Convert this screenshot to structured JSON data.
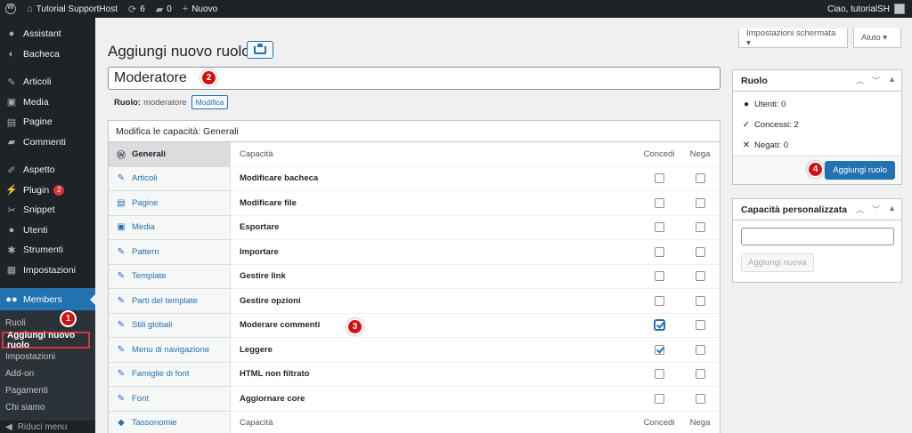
{
  "admin_bar": {
    "site_name": "Tutorial SupportHost",
    "updates_count": "6",
    "comments_count": "0",
    "new_label": "Nuovo",
    "greeting": "Ciao, tutorialSH"
  },
  "sidebar": {
    "items": [
      {
        "label": "Assistant",
        "icon": "person-icon"
      },
      {
        "label": "Bacheca",
        "icon": "dashboard-icon"
      },
      {
        "label": "Articoli",
        "icon": "pin-icon"
      },
      {
        "label": "Media",
        "icon": "media-icon"
      },
      {
        "label": "Pagine",
        "icon": "page-icon"
      },
      {
        "label": "Commenti",
        "icon": "comment-icon"
      },
      {
        "label": "Aspetto",
        "icon": "brush-icon"
      },
      {
        "label": "Plugin",
        "icon": "plugin-icon",
        "badge": "2"
      },
      {
        "label": "Snippet",
        "icon": "scissors-icon"
      },
      {
        "label": "Utenti",
        "icon": "user-icon"
      },
      {
        "label": "Strumenti",
        "icon": "wrench-icon"
      },
      {
        "label": "Impostazioni",
        "icon": "settings-icon"
      }
    ],
    "current": {
      "label": "Members",
      "icon": "members-icon"
    },
    "submenu": [
      "Ruoli",
      "Aggiungi nuovo ruolo",
      "Impostazioni",
      "Add-on",
      "Pagamenti",
      "Chi siamo"
    ],
    "collapse_label": "Riduci menu"
  },
  "markers": [
    "1",
    "2",
    "3",
    "4"
  ],
  "screen_options": {
    "screen_label": "Impostazioni schermata ▾",
    "help_label": "Aiuto ▾"
  },
  "page": {
    "title": "Aggiungi nuovo ruolo",
    "role_name_value": "Moderatore",
    "role_label": "Ruolo:",
    "role_slug": "moderatore",
    "edit_label": "Modifica"
  },
  "capabilities": {
    "heading": "Modifica le capacità: Generali",
    "tabs": [
      {
        "label": "Generali",
        "icon": "wordpress-icon"
      },
      {
        "label": "Articoli",
        "icon": "pin-icon"
      },
      {
        "label": "Pagine",
        "icon": "page-icon"
      },
      {
        "label": "Media",
        "icon": "media-icon"
      },
      {
        "label": "Pattern",
        "icon": "pin-icon"
      },
      {
        "label": "Template",
        "icon": "pin-icon"
      },
      {
        "label": "Parti del template",
        "icon": "pin-icon"
      },
      {
        "label": "Stili globali",
        "icon": "pin-icon"
      },
      {
        "label": "Menu di navigazione",
        "icon": "pin-icon"
      },
      {
        "label": "Famiglie di font",
        "icon": "pin-icon"
      },
      {
        "label": "Font",
        "icon": "pin-icon"
      },
      {
        "label": "Tassonomie",
        "icon": "tag-icon"
      }
    ],
    "column_capability": "Capacità",
    "column_grant": "Concedi",
    "column_deny": "Nega",
    "rows": [
      {
        "label": "Modificare bacheca",
        "grant": false,
        "deny": false
      },
      {
        "label": "Modificare file",
        "grant": false,
        "deny": false
      },
      {
        "label": "Esportare",
        "grant": false,
        "deny": false
      },
      {
        "label": "Importare",
        "grant": false,
        "deny": false
      },
      {
        "label": "Gestire link",
        "grant": false,
        "deny": false
      },
      {
        "label": "Gestire opzioni",
        "grant": false,
        "deny": false
      },
      {
        "label": "Moderare commenti",
        "grant": true,
        "deny": false
      },
      {
        "label": "Leggere",
        "grant": true,
        "deny": false
      },
      {
        "label": "HTML non filtrato",
        "grant": false,
        "deny": false
      },
      {
        "label": "Aggiornare core",
        "grant": false,
        "deny": false
      }
    ]
  },
  "role_box": {
    "title": "Ruolo",
    "users_label": "Utenti: 0",
    "granted_label": "Concessi: 2",
    "denied_label": "Negati: 0",
    "submit_label": "Aggiungi ruolo"
  },
  "custom_cap_box": {
    "title": "Capacità personalizzata",
    "input_value": "",
    "button_label": "Aggiungi nuova"
  }
}
